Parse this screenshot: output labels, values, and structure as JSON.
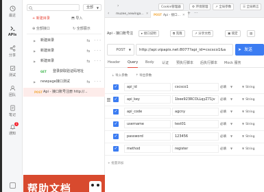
{
  "sidebar": {
    "items": [
      {
        "label": "最近",
        "icon": "clock-icon"
      },
      {
        "label": "APIs",
        "icon": "terminal-icon"
      },
      {
        "label": "分享",
        "icon": "share-icon"
      },
      {
        "label": "测试",
        "icon": "test-icon"
      },
      {
        "label": "团队",
        "icon": "team-icon"
      },
      {
        "label": "笔记",
        "icon": "note-icon"
      },
      {
        "label": "通知",
        "icon": "bell-icon",
        "badge": "1"
      }
    ]
  },
  "tree": {
    "filter_value": "全部",
    "new_api": "+ 新建目录",
    "import": "导入",
    "all_apis": "全部接口",
    "shared": "全部展示",
    "rows": [
      {
        "label": "新建目录"
      },
      {
        "label": "新建目录"
      },
      {
        "label": "新建目录"
      },
      {
        "method": "GET",
        "label": "登录获取验证码地址"
      },
      {
        "label": "newpage接口测试"
      },
      {
        "method": "POST",
        "label": "Api - 接口账号注册 http://..."
      }
    ]
  },
  "banner": {
    "text": "帮助文档"
  },
  "topbar": {
    "buttons": [
      "Cookie管理器",
      "环境管理",
      "全局参数",
      "全局断言"
    ],
    "tabs": [
      {
        "label": "muzee_newinga..."
      },
      {
        "method": "POST",
        "label": "Api - 接口..."
      }
    ]
  },
  "api": {
    "title": "Api - 接口账号注",
    "buttons": [
      "接口说明",
      "克隆",
      "分享文档",
      "锁定"
    ],
    "method": "POST",
    "url": "http://api.vipapis.net:8077?api_id=cscsco1&a",
    "send": "发送"
  },
  "subtabs": [
    "Header",
    "Query",
    "Body",
    "认证",
    "预执行脚本",
    "后执行脚本",
    "Mock 服务"
  ],
  "param_tools": [
    "导入参数",
    "导出参数"
  ],
  "params": [
    {
      "name": "api_id",
      "value": "cscsco1",
      "required": "必填",
      "type": "String"
    },
    {
      "name": "api_key",
      "value": "1bee923RCOLLqyZ71jv",
      "required": "必填",
      "type": "String"
    },
    {
      "name": "api_code",
      "value": "agcny",
      "required": "必填",
      "type": "String"
    },
    {
      "name": "username",
      "value": "test01",
      "required": "必填",
      "type": "String"
    },
    {
      "name": "password",
      "value": "123456",
      "required": "必填",
      "type": "String"
    },
    {
      "name": "method",
      "value": "register",
      "required": "必填",
      "type": "String"
    }
  ],
  "batch": "+ 批量添加",
  "colors": {
    "accent": "#e8483a",
    "primary": "#3b7cf2",
    "post": "#f2a93b",
    "get": "#3ab54a"
  }
}
